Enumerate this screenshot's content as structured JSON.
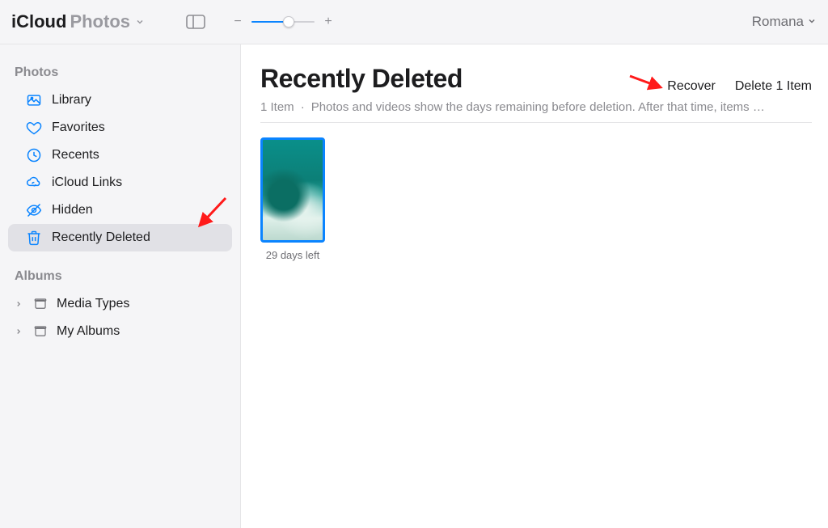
{
  "toolbar": {
    "app_name": "iCloud",
    "section": "Photos",
    "account_name": "Romana"
  },
  "sidebar": {
    "sections": [
      {
        "header": "Photos",
        "items": [
          {
            "id": "library",
            "label": "Library",
            "icon": "library-icon",
            "selected": false
          },
          {
            "id": "favorites",
            "label": "Favorites",
            "icon": "heart-icon",
            "selected": false
          },
          {
            "id": "recents",
            "label": "Recents",
            "icon": "clock-icon",
            "selected": false
          },
          {
            "id": "icloud-links",
            "label": "iCloud Links",
            "icon": "cloud-link-icon",
            "selected": false
          },
          {
            "id": "hidden",
            "label": "Hidden",
            "icon": "eye-off-icon",
            "selected": false
          },
          {
            "id": "recently-deleted",
            "label": "Recently Deleted",
            "icon": "trash-icon",
            "selected": true
          }
        ]
      },
      {
        "header": "Albums",
        "items": [
          {
            "id": "media-types",
            "label": "Media Types",
            "icon": "folder-icon",
            "expandable": true
          },
          {
            "id": "my-albums",
            "label": "My Albums",
            "icon": "folder-icon",
            "expandable": true
          }
        ]
      }
    ]
  },
  "main": {
    "title": "Recently Deleted",
    "item_count_label": "1 Item",
    "description": "Photos and videos show the days remaining before deletion. After that time, items …",
    "actions": {
      "recover_label": "Recover",
      "delete_label": "Delete 1 Item"
    },
    "thumbs": [
      {
        "days_left_label": "29 days left",
        "selected": true
      }
    ]
  },
  "colors": {
    "accent": "#0a84ff",
    "annotation": "#ff1a1a"
  }
}
